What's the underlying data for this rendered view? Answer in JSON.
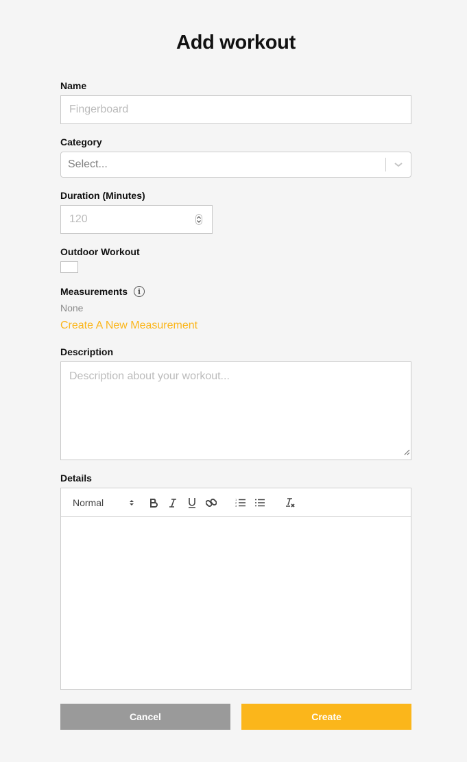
{
  "page": {
    "title": "Add workout"
  },
  "fields": {
    "name": {
      "label": "Name",
      "value": "",
      "placeholder": "Fingerboard"
    },
    "category": {
      "label": "Category",
      "placeholder": "Select..."
    },
    "duration": {
      "label": "Duration (Minutes)",
      "value": "",
      "placeholder": "120"
    },
    "outdoor": {
      "label": "Outdoor Workout",
      "checked": false
    },
    "measurements": {
      "label": "Measurements",
      "info_icon": "info-icon",
      "value": "None",
      "create_link": "Create A New Measurement"
    },
    "description": {
      "label": "Description",
      "value": "",
      "placeholder": "Description about your workout..."
    },
    "details": {
      "label": "Details",
      "toolbar": {
        "format_select": "Normal",
        "buttons": [
          "bold",
          "italic",
          "underline",
          "link",
          "ordered-list",
          "bullet-list",
          "clear-format"
        ]
      },
      "value": ""
    }
  },
  "actions": {
    "cancel_label": "Cancel",
    "create_label": "Create"
  },
  "colors": {
    "accent": "#fbb61b",
    "cancel": "#9a9a9a",
    "background": "#f5f5f5"
  }
}
